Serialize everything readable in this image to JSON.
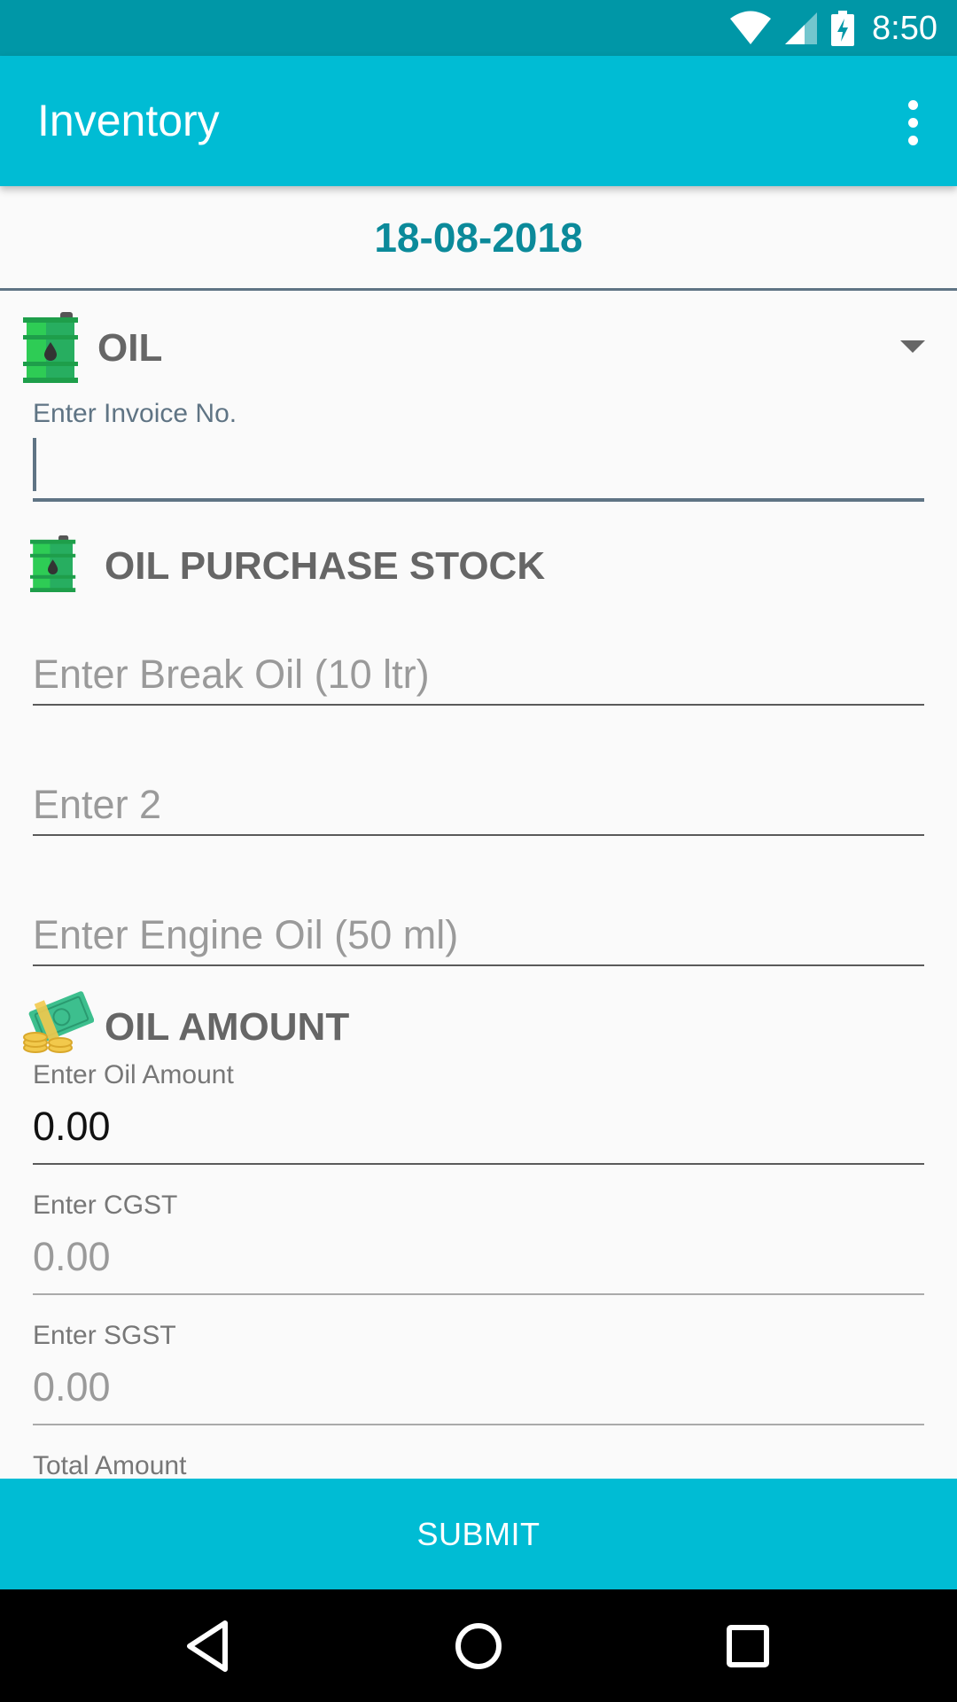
{
  "status_bar": {
    "time": "8:50",
    "icons": [
      "wifi-icon",
      "signal-icon",
      "battery-charging-icon"
    ]
  },
  "app_bar": {
    "title": "Inventory",
    "menu_icon": "overflow-menu-icon"
  },
  "date": "18-08-2018",
  "category_spinner": {
    "selected": "OIL",
    "icon": "oil-barrel-icon"
  },
  "invoice": {
    "label": "Enter Invoice No.",
    "value": ""
  },
  "purchase_section": {
    "title": "OIL PURCHASE STOCK",
    "icon": "oil-barrel-icon",
    "fields": [
      {
        "placeholder": "Enter Break Oil (10 ltr)"
      },
      {
        "placeholder": "Enter 2"
      },
      {
        "placeholder": "Enter Engine Oil (50 ml)"
      }
    ]
  },
  "amount_section": {
    "title": "OIL AMOUNT",
    "icon": "money-coins-icon",
    "oil_amount": {
      "label": "Enter Oil Amount",
      "value": "0.00"
    },
    "cgst": {
      "label": "Enter CGST",
      "placeholder": "0.00"
    },
    "sgst": {
      "label": "Enter SGST",
      "placeholder": "0.00"
    },
    "total_label": "Total Amount"
  },
  "submit_label": "SUBMIT",
  "nav": [
    "back-icon",
    "home-icon",
    "recents-icon"
  ],
  "colors": {
    "primary": "#00bcd4",
    "primary_dark": "#0097a7",
    "date_text": "#0b8a9a",
    "barrel_green": "#2ecc55"
  }
}
